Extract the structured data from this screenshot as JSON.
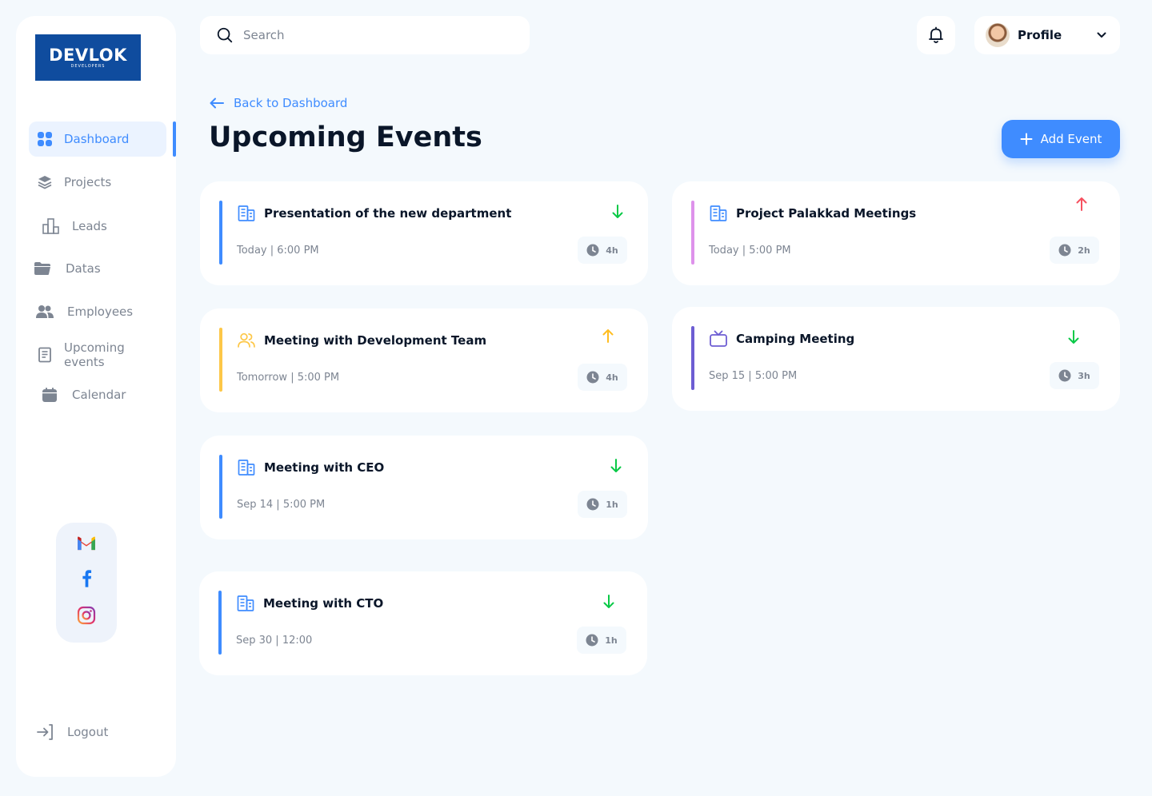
{
  "brand": {
    "logo_main": "DEVLOK",
    "logo_sub": "DEVELOPERS"
  },
  "sidebar": {
    "items": [
      {
        "label": "Dashboard",
        "icon": "grid-icon",
        "active": true
      },
      {
        "label": "Projects",
        "icon": "layers-icon"
      },
      {
        "label": "Leads",
        "icon": "bar-chart-icon"
      },
      {
        "label": "Datas",
        "icon": "folder-icon"
      },
      {
        "label": "Employees",
        "icon": "users-icon"
      },
      {
        "label": "Upcoming events",
        "icon": "document-icon"
      },
      {
        "label": "Calendar",
        "icon": "calendar-icon"
      }
    ],
    "social": [
      "gmail-icon",
      "facebook-icon",
      "instagram-icon"
    ],
    "logout_label": "Logout"
  },
  "topbar": {
    "search_placeholder": "Search",
    "profile_label": "Profile"
  },
  "header": {
    "back_label": "Back to Dashboard",
    "title": "Upcoming Events",
    "add_label": "Add Event"
  },
  "events": [
    {
      "title": "Presentation of the new department",
      "date": "Today | 6:00 PM",
      "duration": "4h",
      "priority": "low",
      "bar_color": "#3F8CFF",
      "icon": "building-icon"
    },
    {
      "title": "Project Palakkad Meetings",
      "date": "Today | 5:00 PM",
      "duration": "2h",
      "priority": "high",
      "bar_color": "#DE92EB",
      "icon": "building-icon"
    },
    {
      "title": "Meeting with Development Team",
      "date": "Tomorrow | 5:00 PM",
      "duration": "4h",
      "priority": "medium",
      "bar_color": "#FDC748",
      "icon": "team-icon"
    },
    {
      "title": "Camping Meeting",
      "date": "Sep 15 | 5:00 PM",
      "duration": "3h",
      "priority": "low",
      "bar_color": "#6D5DD3",
      "icon": "tv-icon"
    },
    {
      "title": "Meeting with CEO",
      "date": "Sep 14 | 5:00 PM",
      "duration": "1h",
      "priority": "low",
      "bar_color": "#3F8CFF",
      "icon": "building-icon"
    },
    {
      "title": "Meeting with CTO",
      "date": "Sep 30 | 12:00",
      "duration": "1h",
      "priority": "low",
      "bar_color": "#3F8CFF",
      "icon": "building-icon"
    }
  ],
  "colors": {
    "accent": "#3F8CFF",
    "text": "#0A1629",
    "muted": "#7D8592",
    "bg": "#F4F9FD",
    "up_high": "#F65160",
    "up_medium": "#FFBD21",
    "down_low": "#0AC947"
  }
}
